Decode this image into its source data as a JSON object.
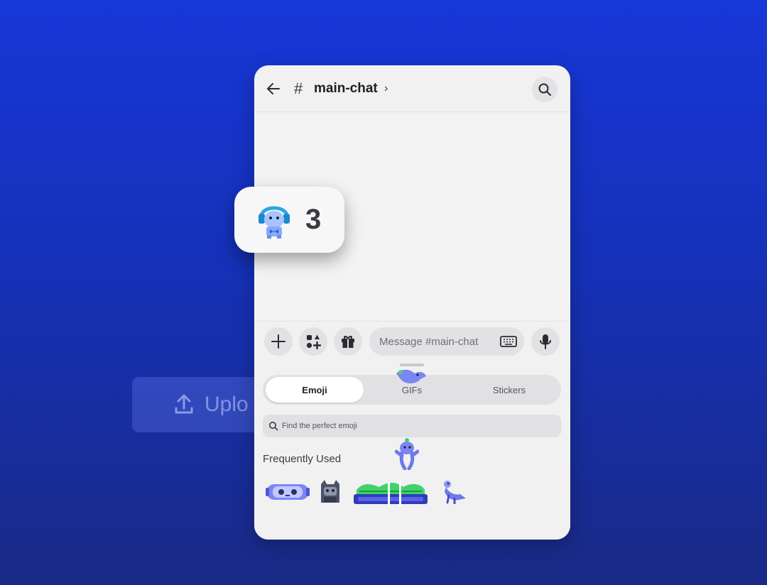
{
  "background_ghost": {
    "upload_label": "Uplo"
  },
  "header": {
    "hash": "#",
    "channel_name": "main-chat",
    "chevron": "›",
    "icons": [
      "back-arrow-icon",
      "search-icon"
    ]
  },
  "composer": {
    "placeholder": "Message #main-chat",
    "buttons": [
      "add-icon",
      "apps-icon",
      "gift-icon",
      "keyboard-icon",
      "microphone-icon"
    ]
  },
  "picker": {
    "tabs": [
      {
        "label": "Emoji",
        "active": true
      },
      {
        "label": "GIFs",
        "active": false
      },
      {
        "label": "Stickers",
        "active": false
      }
    ],
    "search_placeholder": "Find the perfect emoji",
    "section_title": "Frequently Used",
    "emojis": [
      "robot-face-emoji",
      "gray-cat-emoji",
      "green-sofa-emoji",
      "blue-bird-emoji"
    ]
  },
  "counter": {
    "value": "3",
    "avatar": "blue-headphones-mascot"
  },
  "colors": {
    "bg": "#1737d8",
    "panel": "#f1f1f2",
    "blurple": "#5865f2"
  }
}
